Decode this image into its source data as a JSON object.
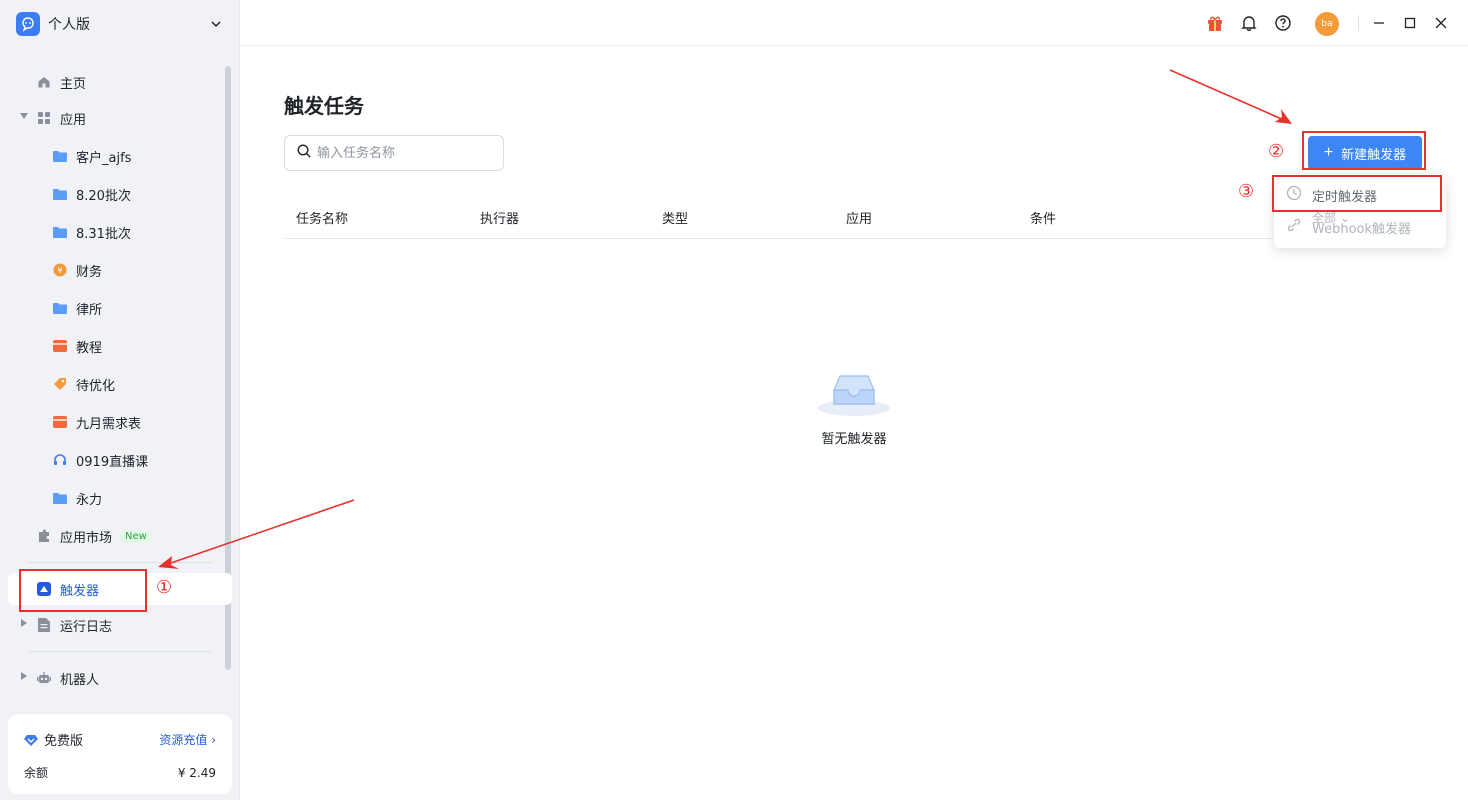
{
  "workspace": {
    "name": "个人版"
  },
  "sidebar": {
    "home": "主页",
    "apps_group": "应用",
    "apps": [
      {
        "label": "客户_ajfs",
        "icon": "folder-icon"
      },
      {
        "label": "8.20批次",
        "icon": "folder-icon"
      },
      {
        "label": "8.31批次",
        "icon": "folder-icon"
      },
      {
        "label": "财务",
        "icon": "yen-icon"
      },
      {
        "label": "律所",
        "icon": "folder-icon"
      },
      {
        "label": "教程",
        "icon": "card-icon"
      },
      {
        "label": "待优化",
        "icon": "tag-icon"
      },
      {
        "label": "九月需求表",
        "icon": "card-icon"
      },
      {
        "label": "0919直播课",
        "icon": "headset-icon"
      },
      {
        "label": "永力",
        "icon": "folder-icon"
      }
    ],
    "market": "应用市场",
    "market_badge": "New",
    "triggers": "触发器",
    "logs": "运行日志",
    "robots": "机器人"
  },
  "plan": {
    "name": "免费版",
    "recharge": "资源充值",
    "balance_label": "余额",
    "balance_value": "¥ 2.49"
  },
  "topbar": {
    "avatar": "ba"
  },
  "main": {
    "title": "触发任务",
    "search_placeholder": "输入任务名称",
    "new_button": "新建触发器",
    "columns": [
      "任务名称",
      "执行器",
      "类型",
      "应用",
      "条件"
    ],
    "empty_text": "暂无触发器"
  },
  "dropdown": {
    "items": [
      "定时触发器",
      "Webhook触发器"
    ],
    "overlay_text": "全部"
  },
  "annotations": [
    "①",
    "②",
    "③"
  ],
  "colors": {
    "accent": "#3d86f6",
    "active_text": "#245bdb",
    "annotation": "#e8302c",
    "sidebar_bg": "#f0f2f7"
  }
}
